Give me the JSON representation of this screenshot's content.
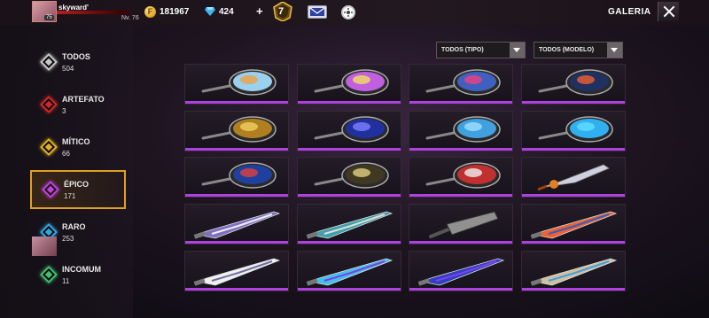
{
  "header": {
    "player_name": "skyward'",
    "player_level": "75",
    "player_rank": "Nv. 76",
    "coins": "181967",
    "diamonds": "424",
    "plus": "+",
    "rank_badge": "7",
    "title": "GALERIA",
    "icons": [
      "coin-icon",
      "diamond-icon",
      "rank-badge-icon",
      "mail-icon",
      "settings-icon",
      "close-icon"
    ]
  },
  "sidebar": {
    "items": [
      {
        "label": "TODOS",
        "count": "504",
        "color": "#c8c8c8"
      },
      {
        "label": "ARTEFATO",
        "count": "3",
        "color": "#d02828"
      },
      {
        "label": "MÍTICO",
        "count": "66",
        "color": "#e0b020"
      },
      {
        "label": "ÉPICO",
        "count": "171",
        "color": "#c040e0"
      },
      {
        "label": "RARO",
        "count": "253",
        "color": "#30a8e0"
      },
      {
        "label": "INCOMUM",
        "count": "11",
        "color": "#40c070"
      }
    ],
    "active_index": 3
  },
  "filters": {
    "type_label": "TODOS (TIPO)",
    "model_label": "TODOS (MODELO)"
  },
  "grid": {
    "rarity_color": "#b040e0",
    "items": [
      {
        "kind": "pan",
        "colors": [
          "#9ad0f0",
          "#f0a040"
        ]
      },
      {
        "kind": "pan",
        "colors": [
          "#c060e0",
          "#f0e060"
        ]
      },
      {
        "kind": "pan",
        "colors": [
          "#4060c0",
          "#f04080"
        ]
      },
      {
        "kind": "pan",
        "colors": [
          "#203060",
          "#f06030"
        ]
      },
      {
        "kind": "pan",
        "colors": [
          "#b08020",
          "#f0d060"
        ]
      },
      {
        "kind": "pan",
        "colors": [
          "#2030a0",
          "#8080ff"
        ]
      },
      {
        "kind": "pan",
        "colors": [
          "#40a0e0",
          "#a0e0ff"
        ]
      },
      {
        "kind": "pan",
        "colors": [
          "#30b0f0",
          "#60e0ff"
        ]
      },
      {
        "kind": "pan",
        "colors": [
          "#2040a0",
          "#e04040"
        ]
      },
      {
        "kind": "pan",
        "colors": [
          "#403820",
          "#e0d080"
        ]
      },
      {
        "kind": "pan",
        "colors": [
          "#c03030",
          "#f0f0f0"
        ]
      },
      {
        "kind": "knife",
        "colors": [
          "#d0d0e0",
          "#e08020"
        ]
      },
      {
        "kind": "sword",
        "colors": [
          "#8070c0",
          "#f0f0ff"
        ]
      },
      {
        "kind": "sword",
        "colors": [
          "#40a0b0",
          "#e0e0d0"
        ]
      },
      {
        "kind": "cleaver",
        "colors": [
          "#909090",
          "#303030"
        ]
      },
      {
        "kind": "sword",
        "colors": [
          "#f06030",
          "#3060c0"
        ]
      },
      {
        "kind": "sword",
        "colors": [
          "#f0f0f0",
          "#7070a0"
        ]
      },
      {
        "kind": "sword",
        "colors": [
          "#40c0f0",
          "#8040e0"
        ]
      },
      {
        "kind": "sword",
        "colors": [
          "#3040c0",
          "#8040f0"
        ]
      },
      {
        "kind": "sword",
        "colors": [
          "#d0c0a0",
          "#40a0e0"
        ]
      }
    ]
  }
}
